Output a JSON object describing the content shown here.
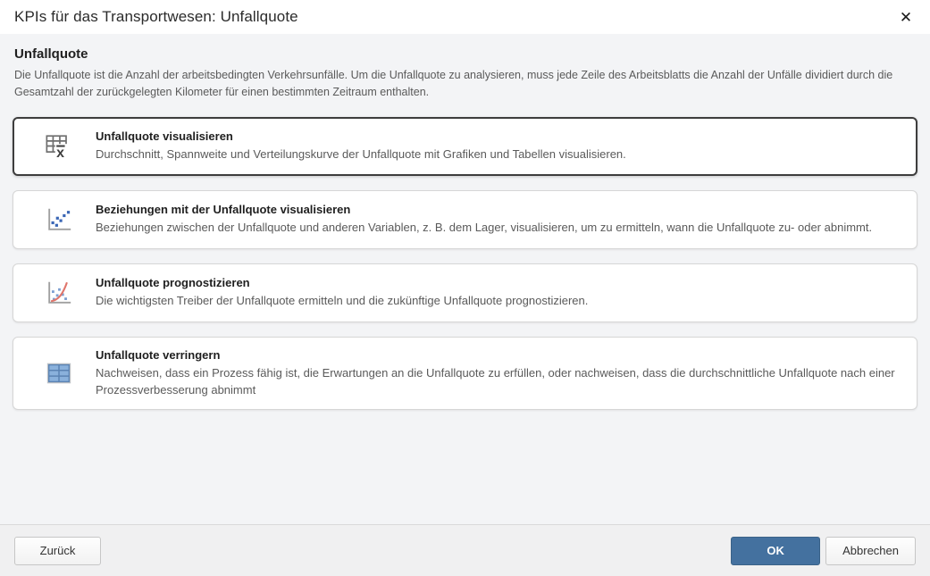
{
  "dialog": {
    "title": "KPIs für das Transportwesen: Unfallquote",
    "close_glyph": "✕"
  },
  "intro": {
    "heading": "Unfallquote",
    "description": "Die Unfallquote ist die Anzahl der arbeitsbedingten Verkehrsunfälle. Um die Unfallquote zu analysieren, muss jede Zeile des Arbeitsblatts die Anzahl der Unfälle dividiert durch die Gesamtzahl der zurückgelegten Kilometer für einen bestimmten Zeitraum enthalten."
  },
  "options": [
    {
      "id": "visualisieren",
      "icon": "table-mean-icon",
      "title": "Unfallquote visualisieren",
      "description": "Durchschnitt, Spannweite und Verteilungskurve der Unfallquote mit Grafiken und Tabellen visualisieren.",
      "selected": true
    },
    {
      "id": "beziehungen",
      "icon": "scatterplot-icon",
      "title": "Beziehungen mit der Unfallquote visualisieren",
      "description": "Beziehungen zwischen der Unfallquote und anderen Variablen, z. B. dem Lager, visualisieren, um zu ermitteln, wann die Unfallquote zu- oder abnimmt.",
      "selected": false
    },
    {
      "id": "prognostizieren",
      "icon": "trend-curve-icon",
      "title": "Unfallquote prognostizieren",
      "description": "Die wichtigsten Treiber der Unfallquote ermitteln und die zukünftige Unfallquote prognostizieren.",
      "selected": false
    },
    {
      "id": "verringern",
      "icon": "capability-table-icon",
      "title": "Unfallquote verringern",
      "description": "Nachweisen, dass ein Prozess fähig ist, die Erwartungen an die Unfallquote zu erfüllen, oder nachweisen, dass die durchschnittliche Unfallquote nach einer Prozessverbesserung abnimmt",
      "selected": false
    }
  ],
  "footer": {
    "back_label": "Zurück",
    "ok_label": "OK",
    "cancel_label": "Abbrechen"
  },
  "colors": {
    "primary_button": "#44719f",
    "selected_card_border": "#3d3d3d",
    "scatter_dot_blue": "#3a66b5",
    "trend_line_red": "#e0756b",
    "capability_table_blue": "#8ab1dc",
    "body_background": "#f3f4f6"
  }
}
